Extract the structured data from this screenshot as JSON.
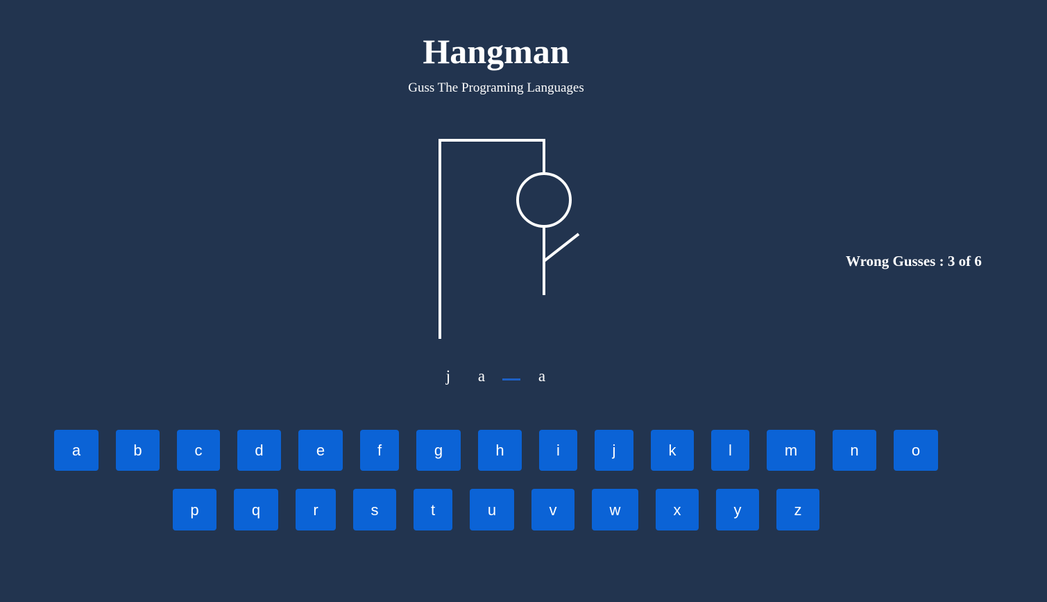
{
  "header": {
    "title": "Hangman",
    "subtitle": "Guss The Programing Languages"
  },
  "game": {
    "wrong_guesses_text": "Wrong Gusses : 3 of 6",
    "wrong_count": 3,
    "max_wrong": 6,
    "hangman_parts_shown": [
      "head",
      "body",
      "right-arm"
    ]
  },
  "word": {
    "letters": [
      "j",
      "a",
      "",
      "a"
    ]
  },
  "keyboard": {
    "row1": [
      "a",
      "b",
      "c",
      "d",
      "e",
      "f",
      "g",
      "h",
      "i",
      "j",
      "k",
      "l",
      "m",
      "n",
      "o"
    ],
    "row2": [
      "p",
      "q",
      "r",
      "s",
      "t",
      "u",
      "v",
      "w",
      "x",
      "y",
      "z"
    ]
  },
  "colors": {
    "background": "#22344f",
    "key": "#0b63d6",
    "blank_underline": "#1d5fc4",
    "text": "#ffffff"
  }
}
